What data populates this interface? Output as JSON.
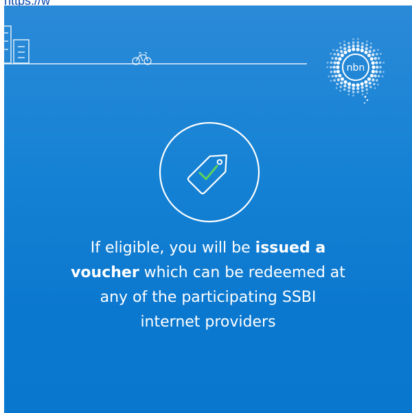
{
  "header": {
    "link_text": "https://w"
  },
  "logo": {
    "text": "nbn"
  },
  "message": {
    "line1_pre": "If eligible, you will be ",
    "line1_bold": "issued a",
    "line2_bold": "voucher",
    "line2_post": " which can be redeemed at",
    "line3": "any of the participating SSBI",
    "line4": "internet providers"
  },
  "colors": {
    "background": "#1682d4",
    "foreground": "#ffffff",
    "check": "#5ed35a"
  },
  "icons": {
    "buildings": "buildings-icon",
    "bicycle": "bicycle-icon",
    "logo": "nbn-logo",
    "tag": "tag-check-icon"
  }
}
